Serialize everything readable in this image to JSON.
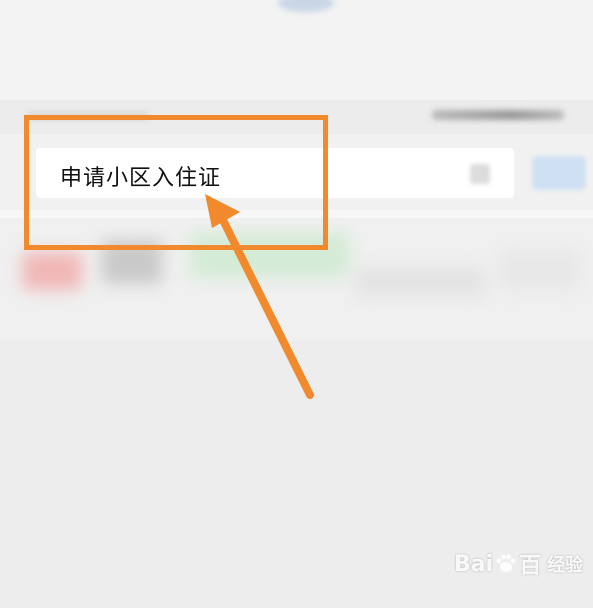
{
  "search": {
    "query": "申请小区入住证"
  },
  "colors": {
    "annotation": "#f08a2c",
    "background": "#efefef"
  },
  "watermark": {
    "brand_left": "Bai",
    "brand_right": "百",
    "suffix": "经验",
    "icon": "paw-icon"
  }
}
